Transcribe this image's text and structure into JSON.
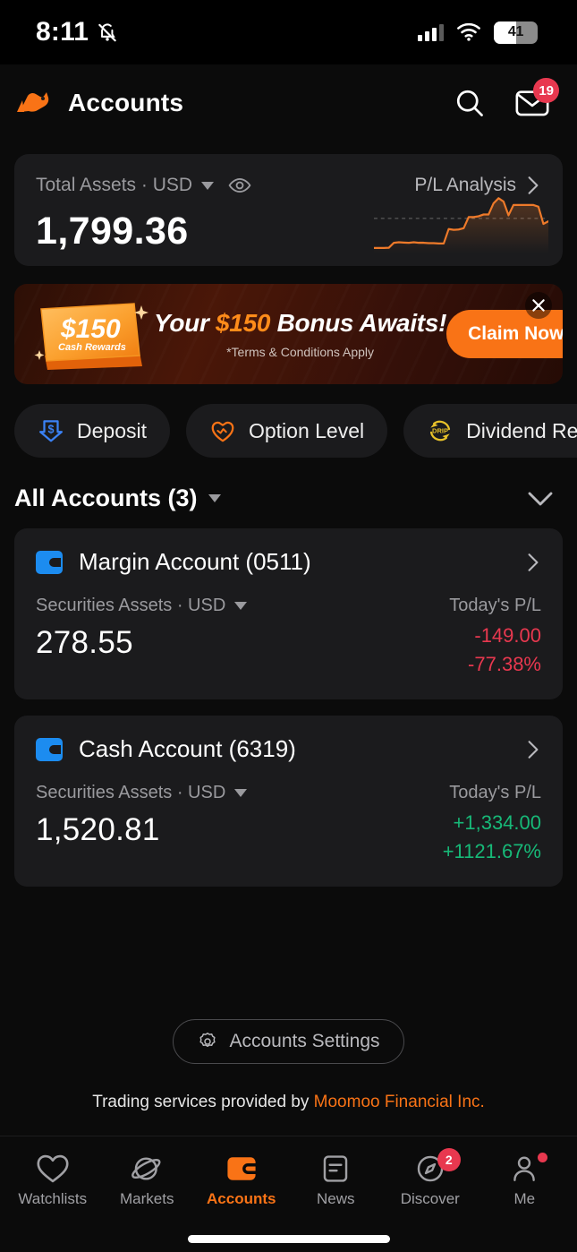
{
  "status_bar": {
    "time": "8:11",
    "silent_icon": "bell-off-icon",
    "battery_level": "41",
    "signal_icon": "cellular-signal-icon",
    "wifi_icon": "wifi-icon"
  },
  "header": {
    "title": "Accounts",
    "logo_icon": "moomoo-bull-logo",
    "search_icon": "search-icon",
    "mail_icon": "mail-icon",
    "mail_badge": "19"
  },
  "assets_card": {
    "label": "Total Assets · USD",
    "eye_icon": "eye-icon",
    "pl_link": "P/L Analysis",
    "chevron_icon": "chevron-right-icon",
    "value": "1,799.36",
    "chart": {
      "type": "line",
      "color": "#ee7a2a",
      "reference_line": true,
      "points": [
        2,
        2,
        2,
        2.2,
        8,
        8.5,
        8.2,
        8,
        8.6,
        8,
        8,
        7.6,
        7.6,
        7.2,
        7.2,
        24,
        23,
        23.5,
        25,
        38,
        38,
        39,
        41,
        41,
        54,
        60,
        56,
        40,
        52,
        52,
        52,
        52,
        52,
        50,
        30,
        33
      ]
    }
  },
  "promo": {
    "coupon_amount": "$150",
    "coupon_sub": "Cash Rewards",
    "headline_pre": "Your ",
    "headline_amount": "$150",
    "headline_post": " Bonus Awaits!",
    "terms": "*Terms & Conditions Apply",
    "cta": "Claim Now",
    "close_icon": "close-icon",
    "accent_color": "#f97316"
  },
  "quick_actions": [
    {
      "label": "Deposit",
      "icon": "deposit-arrow-icon",
      "color": "#3b82f6"
    },
    {
      "label": "Option Level",
      "icon": "option-level-icon",
      "color": "#f97316"
    },
    {
      "label": "Dividend Reinvestment",
      "icon": "drip-icon",
      "color": "#e8c22a"
    }
  ],
  "accounts_section": {
    "title": "All Accounts (3)",
    "filter_caret_icon": "caret-down-icon",
    "collapse_icon": "chevron-down-icon"
  },
  "accounts": [
    {
      "name": "Margin Account (0511)",
      "wallet_icon": "wallet-icon",
      "chevron_icon": "chevron-right-icon",
      "assets_label": "Securities Assets · USD",
      "assets_value": "278.55",
      "pl_title": "Today's P/L",
      "pl_amount": "-149.00",
      "pl_percent": "-77.38%",
      "pl_direction": "negative"
    },
    {
      "name": "Cash Account (6319)",
      "wallet_icon": "wallet-icon",
      "chevron_icon": "chevron-right-icon",
      "assets_label": "Securities Assets · USD",
      "assets_value": "1,520.81",
      "pl_title": "Today's P/L",
      "pl_amount": "+1,334.00",
      "pl_percent": "+1121.67%",
      "pl_direction": "positive"
    }
  ],
  "footer": {
    "settings_label": "Accounts Settings",
    "settings_icon": "gear-icon",
    "legal_prefix": "Trading services provided by ",
    "legal_link": "Moomoo Financial Inc."
  },
  "tabbar": [
    {
      "label": "Watchlists",
      "icon": "heart-icon",
      "active": false
    },
    {
      "label": "Markets",
      "icon": "planet-icon",
      "active": false
    },
    {
      "label": "Accounts",
      "icon": "wallet-icon",
      "active": true
    },
    {
      "label": "News",
      "icon": "document-icon",
      "active": false
    },
    {
      "label": "Discover",
      "icon": "compass-icon",
      "active": false,
      "badge": "2"
    },
    {
      "label": "Me",
      "icon": "person-icon",
      "active": false,
      "dot": true
    }
  ]
}
